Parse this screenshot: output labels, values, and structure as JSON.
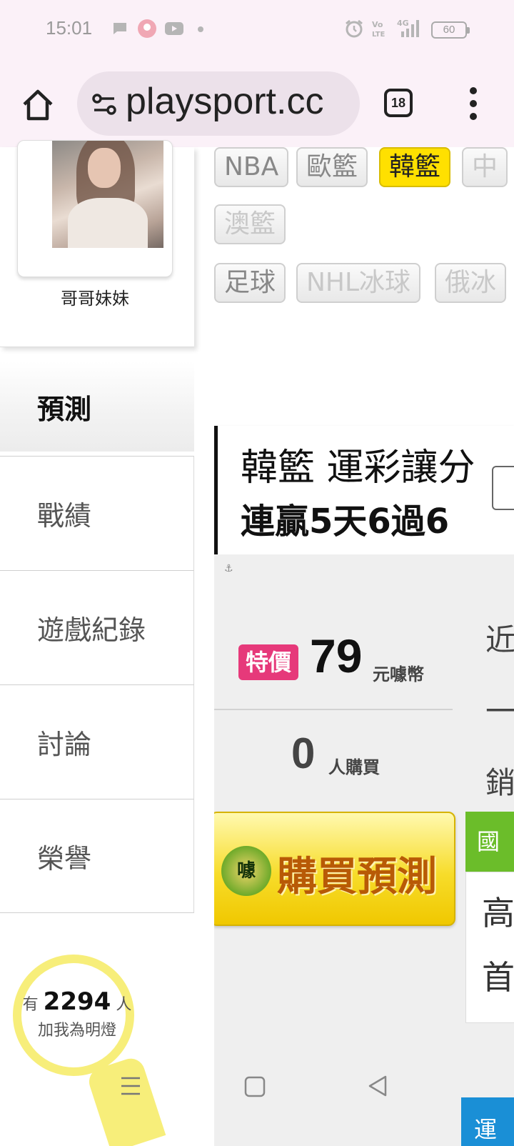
{
  "status_bar": {
    "time": "15:01",
    "battery": "60",
    "icons": [
      "chat-bubble-icon",
      "app-badge-icon",
      "youtube-icon",
      "dot-icon",
      "alarm-icon",
      "volte-icon",
      "signal-4g-icon",
      "battery-icon"
    ]
  },
  "browser": {
    "url": "playsport.cc",
    "tab_count": "18",
    "icons": [
      "home-icon",
      "site-settings-icon",
      "tab-switcher-icon",
      "overflow-menu-icon"
    ]
  },
  "sidebar": {
    "profile_name": "哥哥妹妹",
    "active_section": "預測",
    "items": [
      {
        "label": "戰績"
      },
      {
        "label": "遊戲紀錄"
      },
      {
        "label": "討論"
      },
      {
        "label": "榮譽"
      }
    ],
    "fans": {
      "prefix": "有",
      "count": "2294",
      "suffix": "人",
      "line2": "加我為明燈"
    }
  },
  "leagues": {
    "row1": [
      "NBA",
      "歐籃",
      "韓籃",
      "中"
    ],
    "row2": [
      "澳籃"
    ],
    "row3": [
      "足球",
      "NHL冰球",
      "俄冰"
    ],
    "active": "韓籃"
  },
  "prediction": {
    "title_line1": "韓籃 運彩讓分",
    "title_line2": "連贏5天6過6",
    "special_label": "特價",
    "price": "79",
    "price_unit": "元噱幣",
    "buyers": "0",
    "buyers_unit": "人購買",
    "buy_button": "購買預測",
    "coin_label": "噱",
    "side_text": [
      "近",
      "一",
      "銷"
    ],
    "green_tag": "國",
    "card_text": [
      "高",
      "首"
    ],
    "blue_tag": "運"
  }
}
